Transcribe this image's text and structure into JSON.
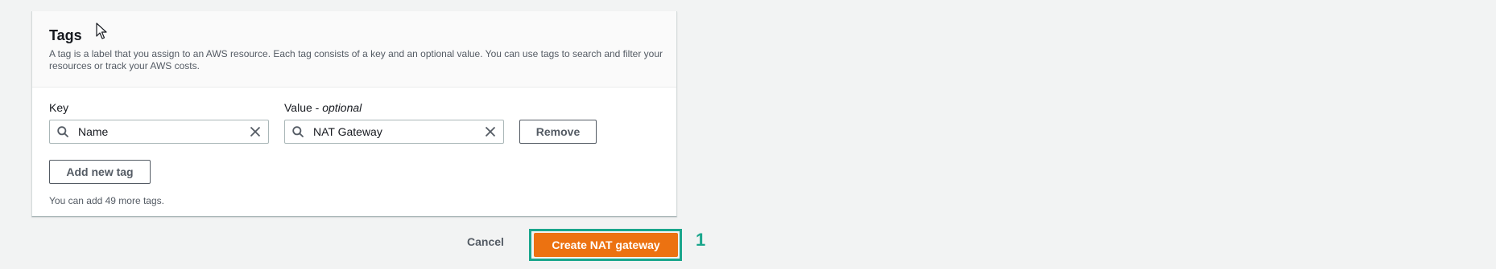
{
  "tags_section": {
    "title": "Tags",
    "description": "A tag is a label that you assign to an AWS resource. Each tag consists of a key and an optional value. You can use tags to search and filter your resources or track your AWS costs.",
    "key_label": "Key",
    "value_label": "Value - ",
    "value_label_optional": "optional",
    "tags": [
      {
        "key": "Name",
        "value": "NAT Gateway"
      }
    ],
    "remove_label": "Remove",
    "add_tag_label": "Add new tag",
    "remaining_hint": "You can add 49 more tags."
  },
  "footer": {
    "cancel_label": "Cancel",
    "create_label": "Create NAT gateway",
    "step_marker": "1"
  },
  "colors": {
    "primary": "#ec7211",
    "highlight": "#1aa68c"
  }
}
